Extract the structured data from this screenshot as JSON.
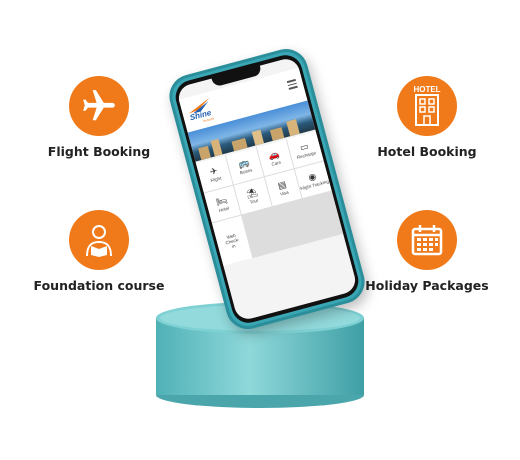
{
  "features": {
    "flight": {
      "label": "Flight Booking",
      "icon": "airplane-icon"
    },
    "hotel": {
      "label": "Hotel Booking",
      "icon": "hotel-building-icon",
      "sign": "HOTEL"
    },
    "foundation": {
      "label": "Foundation course",
      "icon": "student-reading-icon"
    },
    "holiday": {
      "label": "Holiday Packages",
      "icon": "calendar-icon"
    }
  },
  "app": {
    "logo": "Shine",
    "logo_sub": "Network",
    "tiles": [
      {
        "label": "Flight",
        "icon": "✈"
      },
      {
        "label": "Buses",
        "icon": "🚌"
      },
      {
        "label": "Cars",
        "icon": "🚗"
      },
      {
        "label": "Recharge",
        "icon": "▭"
      },
      {
        "label": "Hotel",
        "icon": "🛏"
      },
      {
        "label": "Tour",
        "icon": "⛱"
      },
      {
        "label": "Visa",
        "icon": "▤"
      },
      {
        "label": "Flight Tracking",
        "icon": "◉"
      },
      {
        "label": "Web Check-in",
        "icon": ""
      }
    ]
  },
  "colors": {
    "accent": "#f07a1a",
    "phone": "#3aa7b5",
    "pedestal": "#6cc5c9"
  }
}
